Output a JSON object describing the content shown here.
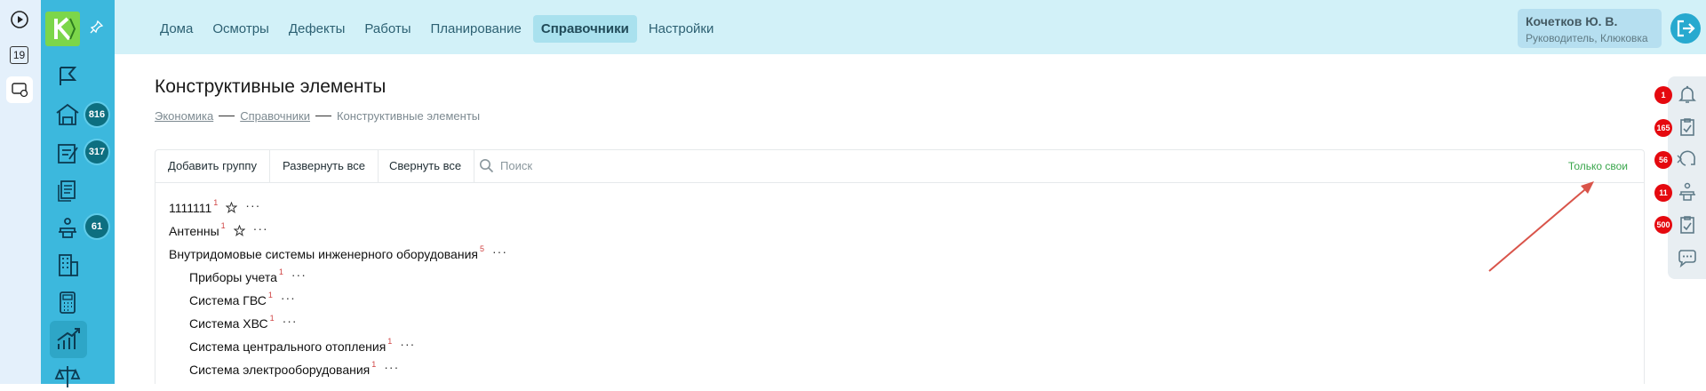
{
  "system": {
    "calendar_day": "19"
  },
  "sidebar": {
    "badges": [
      "816",
      "317",
      "61"
    ]
  },
  "topnav": {
    "items": [
      "Дома",
      "Осмотры",
      "Дефекты",
      "Работы",
      "Планирование",
      "Справочники",
      "Настройки"
    ],
    "active": "Справочники"
  },
  "user": {
    "name": "Кочетков Ю. В.",
    "role": "Руководитель, Клюковка"
  },
  "page": {
    "title": "Конструктивные элементы",
    "breadcrumb": [
      "Экономика",
      "Справочники",
      "Конструктивные элементы"
    ]
  },
  "toolbar": {
    "add_group": "Добавить группу",
    "expand_all": "Развернуть все",
    "collapse_all": "Свернуть все",
    "search_placeholder": "Поиск",
    "only_mine": "Только свои"
  },
  "tree": [
    {
      "label": "1111111",
      "count": "1",
      "level": 0,
      "star": true
    },
    {
      "label": "Антенны",
      "count": "1",
      "level": 0,
      "star": true
    },
    {
      "label": "Внутридомовые системы инженерного оборудования",
      "count": "5",
      "level": 0,
      "star": false
    },
    {
      "label": "Приборы учета",
      "count": "1",
      "level": 1,
      "star": false
    },
    {
      "label": "Система ГВС",
      "count": "1",
      "level": 1,
      "star": false
    },
    {
      "label": "Система ХВС",
      "count": "1",
      "level": 1,
      "star": false
    },
    {
      "label": "Система центрального отопления",
      "count": "1",
      "level": 1,
      "star": false
    },
    {
      "label": "Система электрооборудования",
      "count": "1",
      "level": 1,
      "star": false
    }
  ],
  "rail": {
    "badges": [
      "1",
      "165",
      "56",
      "11",
      "500"
    ]
  },
  "colors": {
    "sidebar": "#3cb8dd",
    "topnav": "#d2f1f8",
    "logo": "#7cd64a",
    "badge": "#0d6f80",
    "alert": "#e5090f",
    "only_mine": "#3aa64c",
    "arrow": "#d9544a"
  }
}
